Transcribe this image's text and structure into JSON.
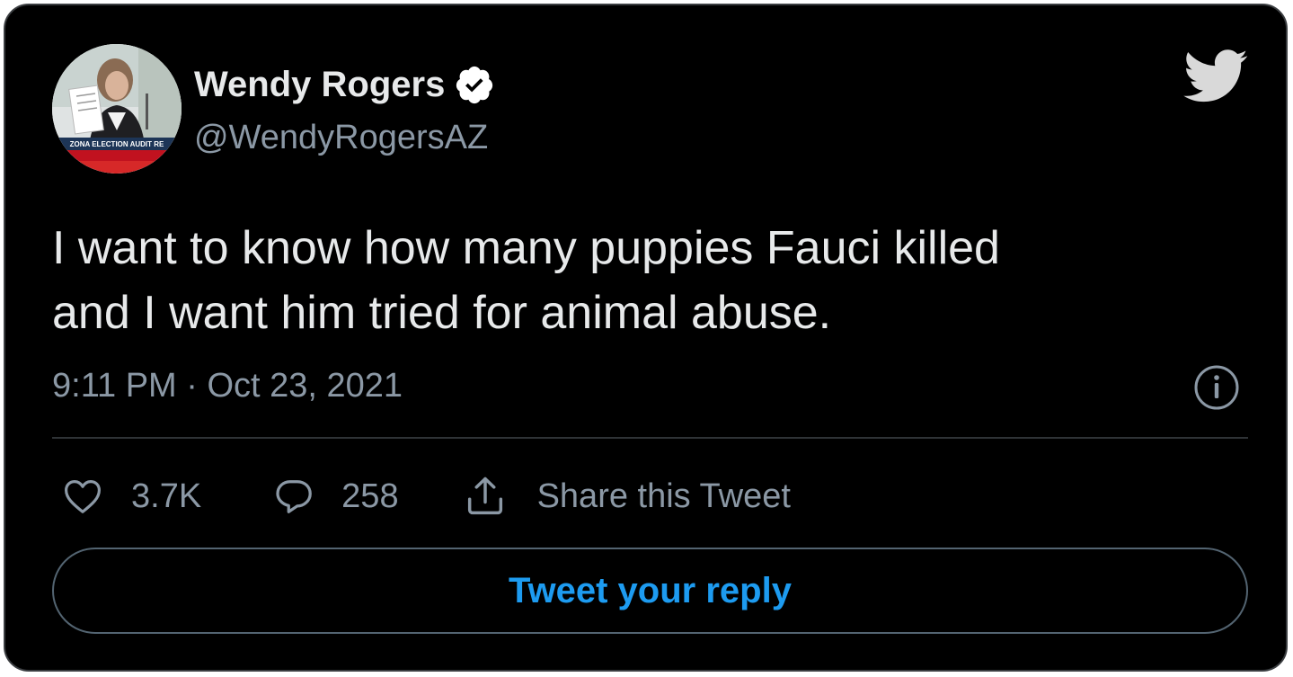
{
  "author": {
    "display_name": "Wendy Rogers",
    "handle": "@WendyRogersAZ",
    "verified_icon": "verified-badge-icon",
    "avatar_banner_text": "ZONA ELECTION AUDIT RE"
  },
  "tweet": {
    "text_lines": [
      "I want to know how many puppies Fauci killed",
      "and I want him tried for animal abuse."
    ],
    "timestamp": "9:11 PM · Oct 23, 2021"
  },
  "actions": {
    "likes": "3.7K",
    "replies": "258",
    "share_label": "Share this Tweet"
  },
  "reply_button": {
    "label": "Tweet your reply"
  },
  "icons": {
    "logo": "twitter-bird-icon",
    "like": "heart-icon",
    "reply": "speech-bubble-icon",
    "share": "share-upload-icon",
    "info": "info-icon"
  },
  "colors": {
    "background": "#000000",
    "primary_text": "#e7e9ea",
    "secondary_text": "#8b98a5",
    "accent": "#1d9bf0",
    "border": "#2f3336"
  }
}
